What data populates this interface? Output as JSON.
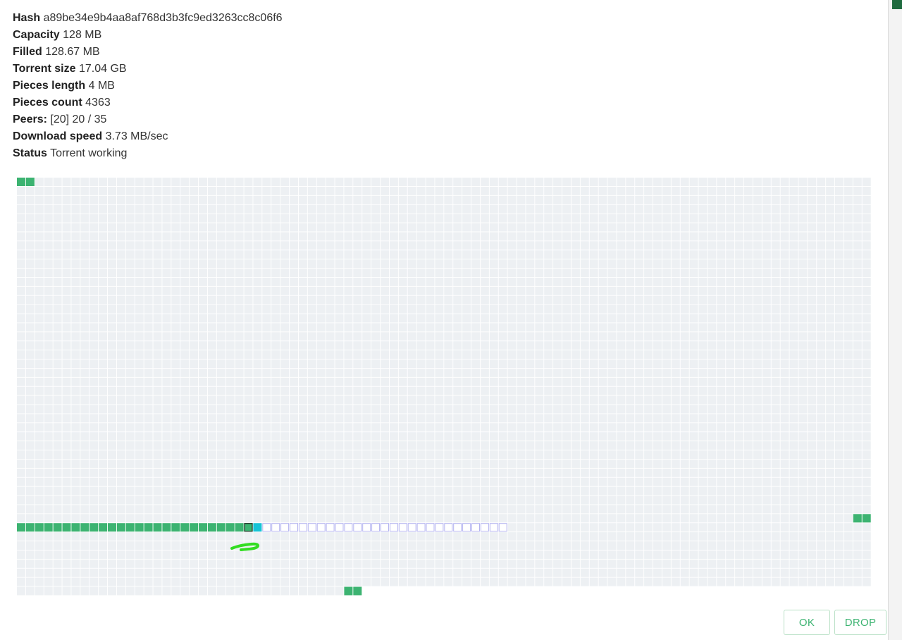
{
  "info": [
    {
      "label": "Hash",
      "value": "a89be34e9b4aa8af768d3b3fc9ed3263cc8c06f6"
    },
    {
      "label": "Capacity",
      "value": "128 MB"
    },
    {
      "label": "Filled",
      "value": "128.67 MB"
    },
    {
      "label": "Torrent size",
      "value": "17.04 GB"
    },
    {
      "label": "Pieces length",
      "value": "4 MB"
    },
    {
      "label": "Pieces count",
      "value": "4363"
    },
    {
      "label": "Peers:",
      "value": "[20] 20 / 35"
    },
    {
      "label": "Download speed",
      "value": "3.73 MB/sec"
    },
    {
      "label": "Status",
      "value": "Torrent working"
    }
  ],
  "buttons": {
    "ok": "OK",
    "drop": "DROP"
  },
  "pieces_map": {
    "columns": 94,
    "rows": 46,
    "last_row_cells": 38,
    "colors": {
      "empty": "#edf0f3",
      "complete": "#3cb371",
      "active": "#17c3d6",
      "queued_border": "#b3b3f0",
      "annotation": "#33dd22"
    },
    "segments": [
      {
        "row": 0,
        "from": 0,
        "to": 1,
        "state": "complete"
      },
      {
        "row": 38,
        "from": 0,
        "to": 24,
        "state": "complete"
      },
      {
        "row": 38,
        "from": 25,
        "to": 25,
        "state": "complete-selected"
      },
      {
        "row": 38,
        "from": 26,
        "to": 26,
        "state": "active"
      },
      {
        "row": 38,
        "from": 27,
        "to": 53,
        "state": "queued"
      },
      {
        "row": 37,
        "from": 92,
        "to": 93,
        "state": "complete"
      },
      {
        "row": 45,
        "from": 36,
        "to": 37,
        "state": "complete"
      },
      {
        "row": 45,
        "from": 38,
        "to": 38,
        "state": "active"
      }
    ]
  }
}
